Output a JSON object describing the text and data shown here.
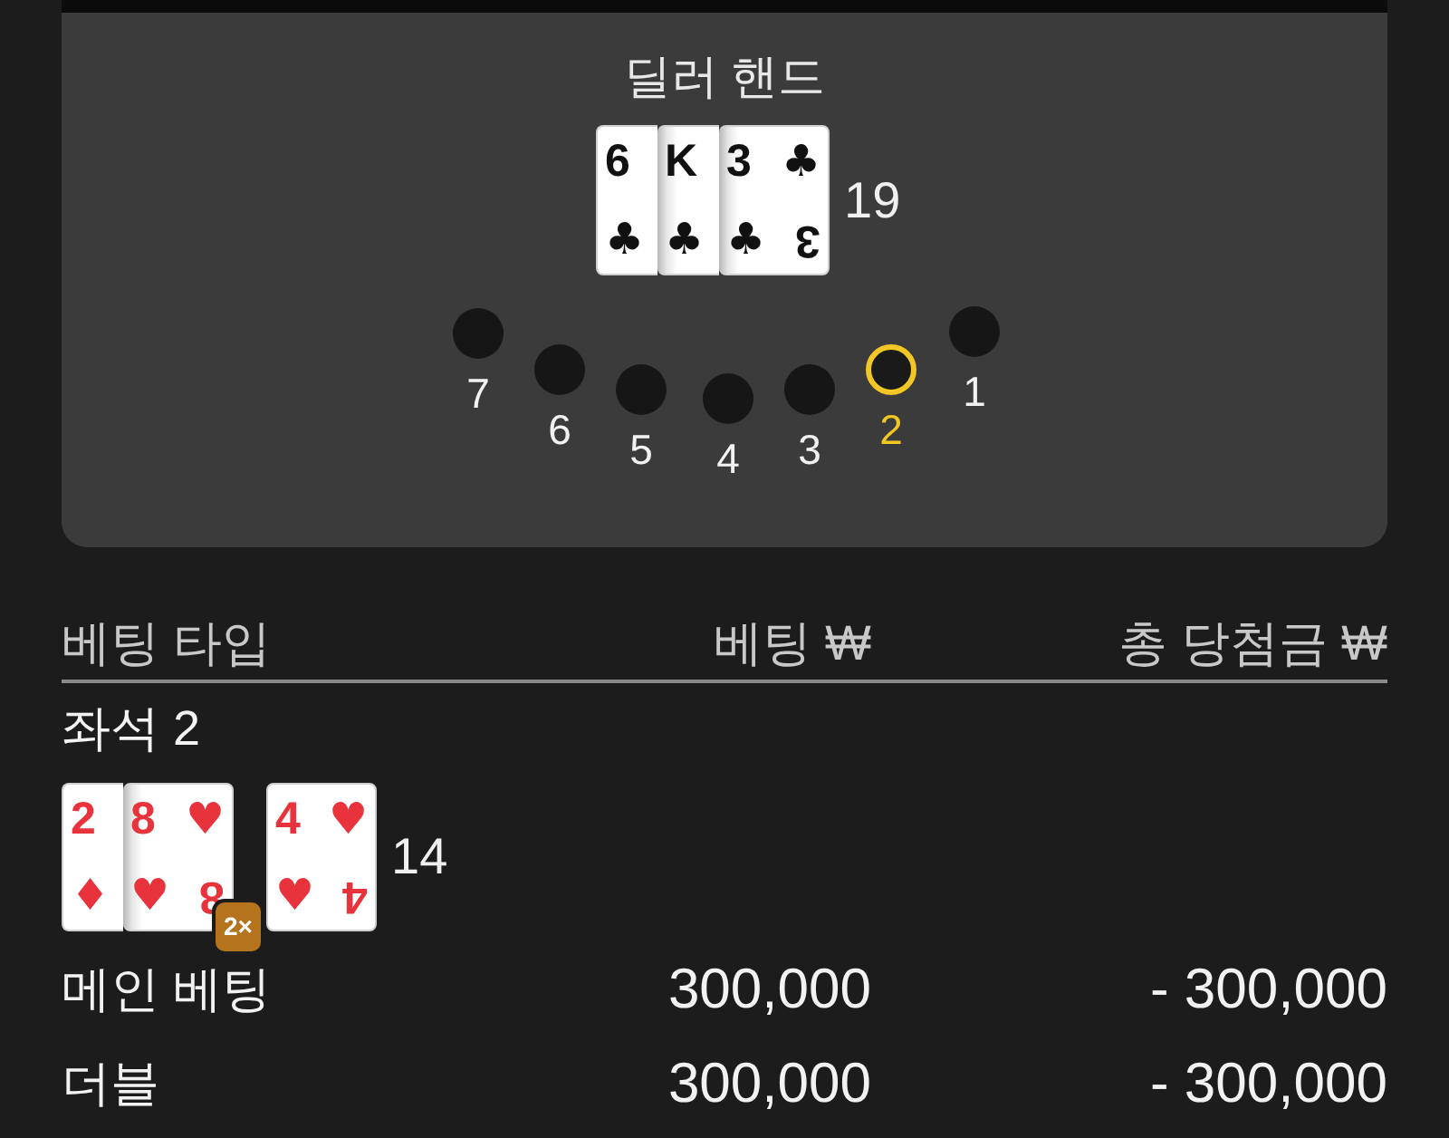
{
  "table": {
    "title": "딜러 핸드",
    "dealer_hand": {
      "cards": [
        {
          "kind": "strip",
          "rank": "6",
          "suit": "♣",
          "color": "#111111"
        },
        {
          "kind": "strip",
          "rank": "K",
          "suit": "♣",
          "color": "#111111"
        },
        {
          "kind": "full",
          "rank": "3",
          "suit": "♣",
          "corner_suit": "♣",
          "corner_rank": "3",
          "color": "#111111"
        }
      ],
      "score": "19"
    },
    "seats": [
      {
        "label": "7",
        "selected": false
      },
      {
        "label": "6",
        "selected": false
      },
      {
        "label": "5",
        "selected": false
      },
      {
        "label": "4",
        "selected": false
      },
      {
        "label": "3",
        "selected": false
      },
      {
        "label": "2",
        "selected": true
      },
      {
        "label": "1",
        "selected": false
      }
    ]
  },
  "bets": {
    "columns": [
      "베팅 타입",
      "베팅 ₩",
      "총 당첨금 ₩"
    ],
    "seat_label": "좌석 2",
    "player_hand": {
      "cards": [
        {
          "kind": "strip",
          "rank": "2",
          "suit": "♦",
          "color": "#e8323c"
        },
        {
          "kind": "full",
          "rank": "8",
          "suit": "♥",
          "corner_suit": "♥",
          "corner_rank": "8",
          "color": "#e8323c"
        }
      ],
      "badge": "2×",
      "double_card": {
        "kind": "full",
        "rank": "4",
        "suit": "♥",
        "corner_suit": "♥",
        "corner_rank": "4",
        "color": "#e8323c"
      },
      "score": "14"
    },
    "rows": [
      {
        "type": "메인 베팅",
        "bet": "300,000",
        "payout": "- 300,000"
      },
      {
        "type": "더블",
        "bet": "300,000",
        "payout": "- 300,000"
      }
    ]
  }
}
